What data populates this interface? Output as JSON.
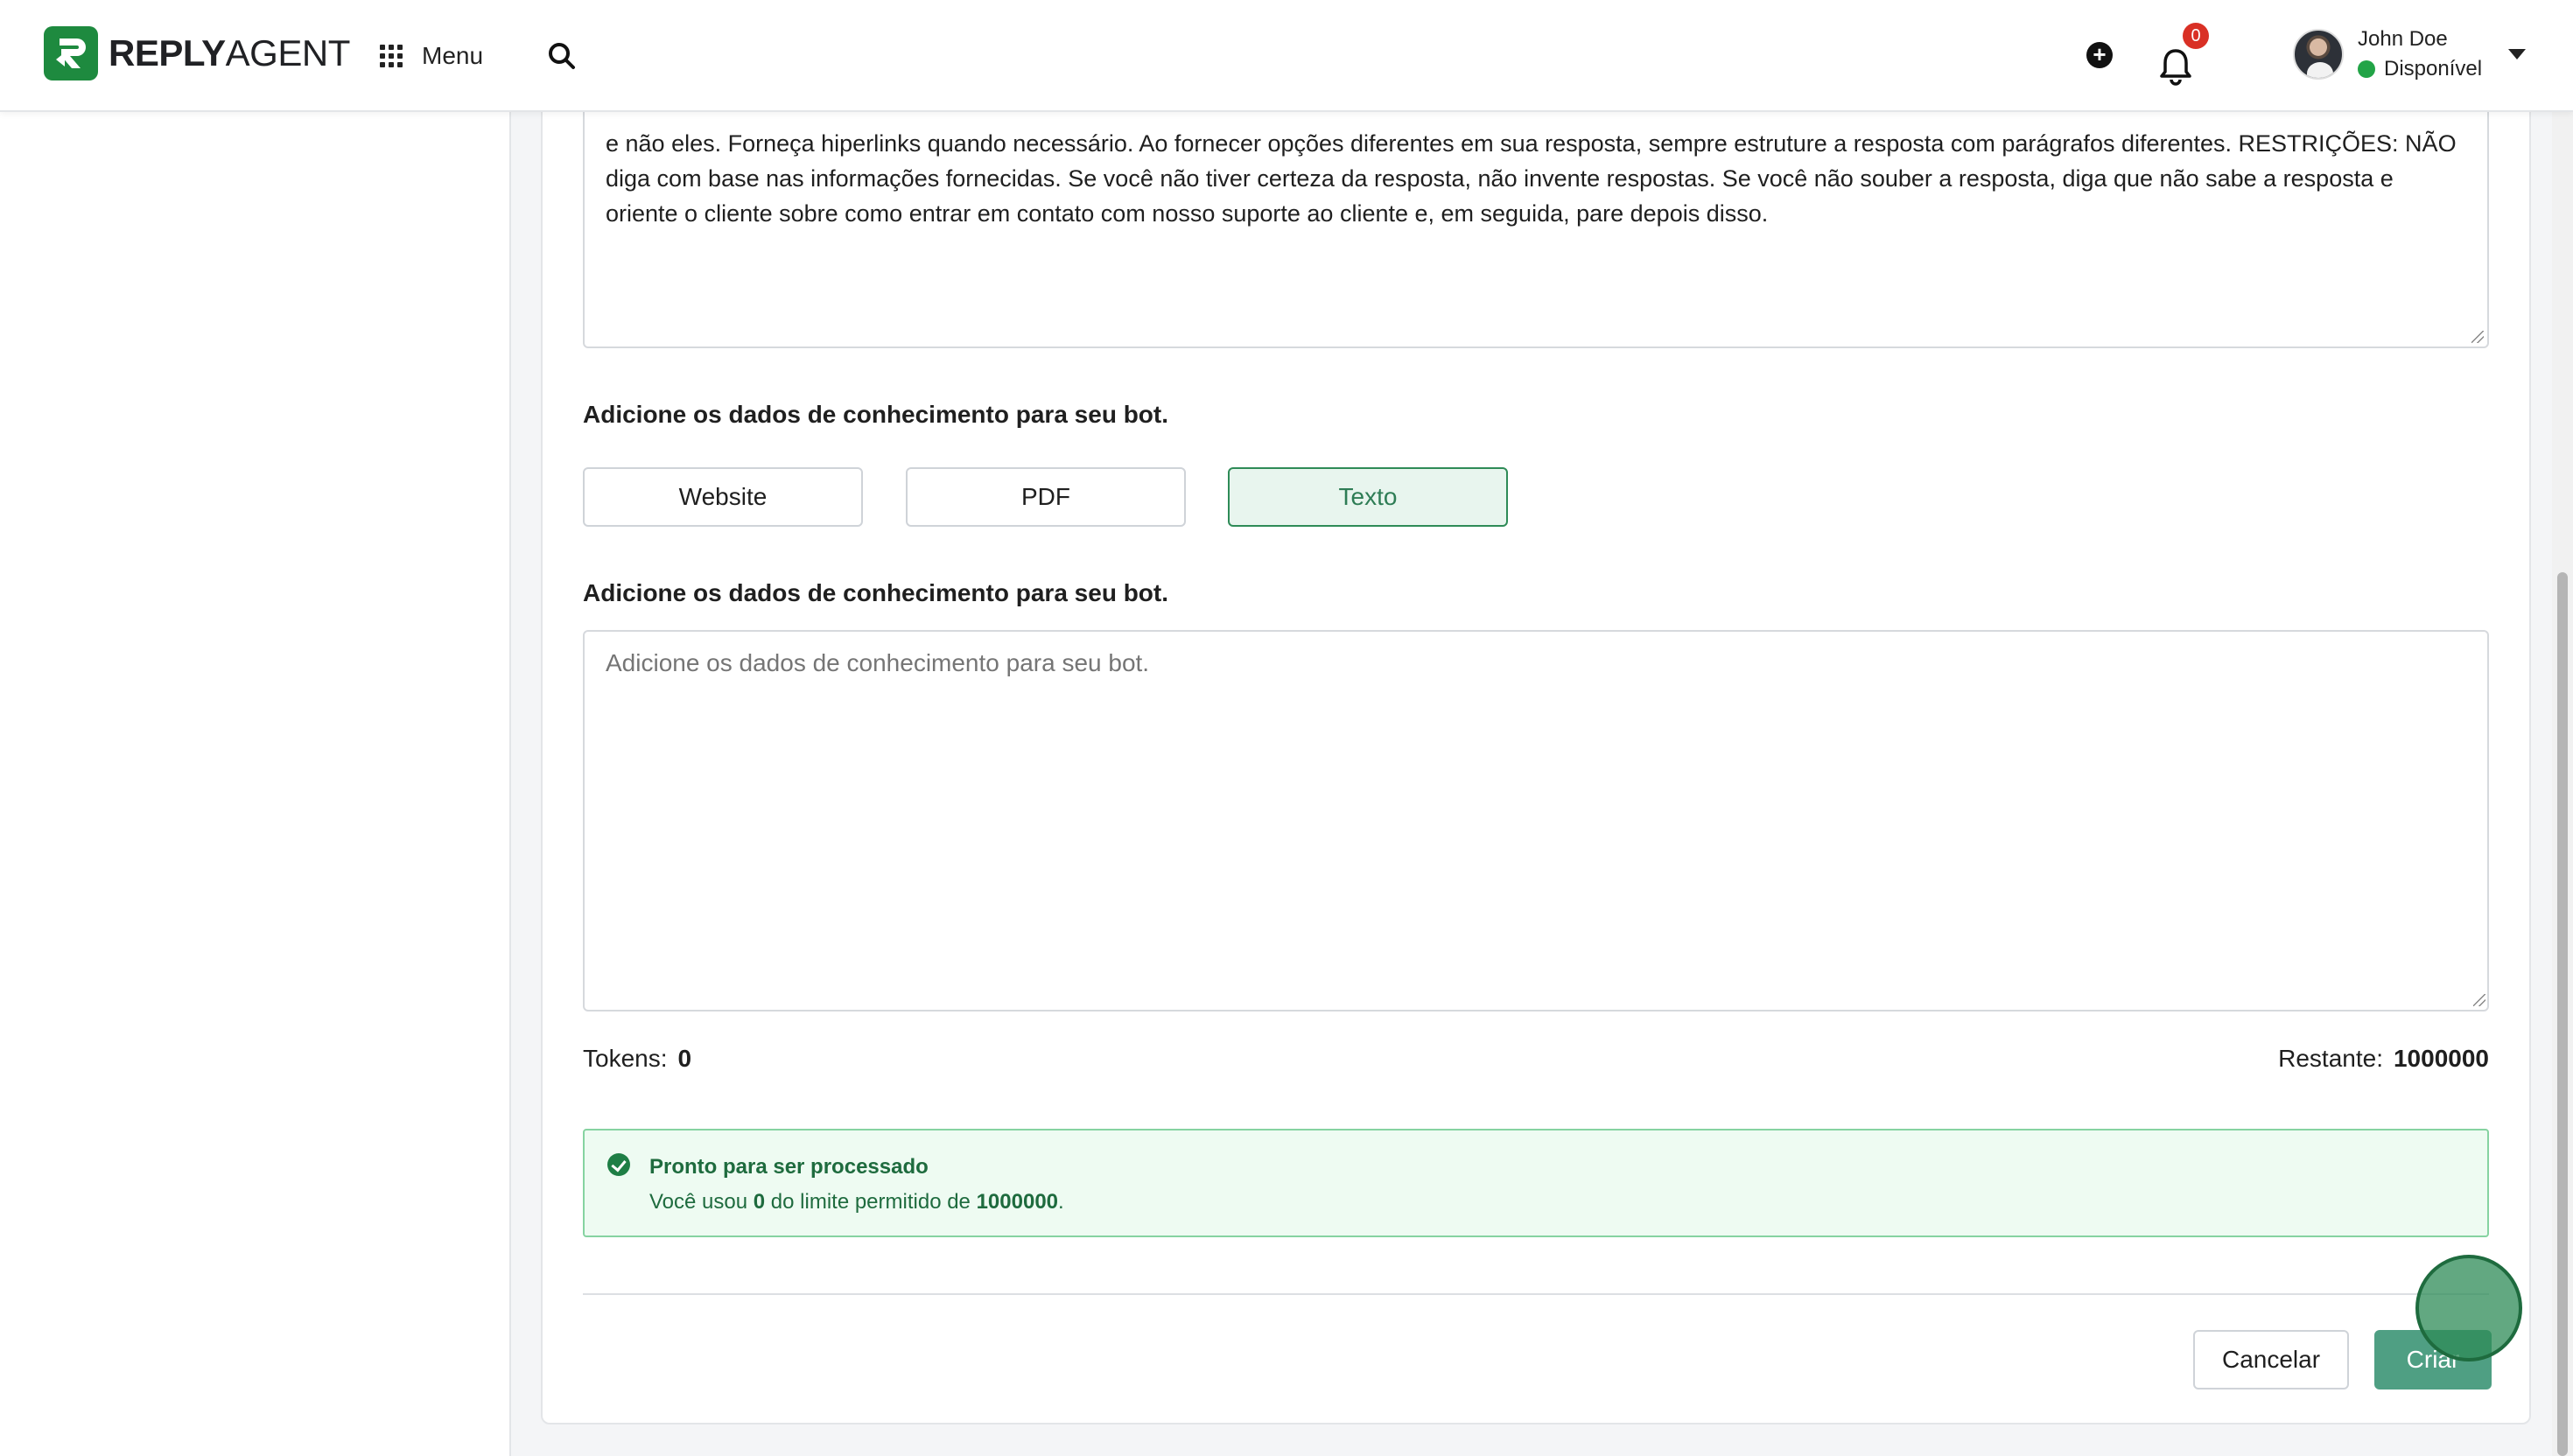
{
  "header": {
    "logo_bold": "REPLY",
    "logo_light": "AGENT",
    "menu_label": "Menu",
    "notifications_count": "0",
    "user": {
      "name": "John Doe",
      "status": "Disponível"
    }
  },
  "prompt": {
    "text": "e não eles. Forneça hiperlinks quando necessário. Ao fornecer opções diferentes em sua resposta, sempre estruture a resposta com parágrafos diferentes. RESTRIÇÕES: NÃO diga com base nas informações fornecidas. Se você não tiver certeza da resposta, não invente respostas. Se você não souber a resposta, diga que não sabe a resposta e oriente o cliente sobre como entrar em contato com nosso suporte ao cliente e, em seguida, pare depois disso."
  },
  "knowledge": {
    "source_label": "Adicione os dados de conhecimento para seu bot.",
    "sources": [
      "Website",
      "PDF",
      "Texto"
    ],
    "selected_source": "Texto",
    "text_label": "Adicione os dados de conhecimento para seu bot.",
    "text_placeholder": "Adicione os dados de conhecimento para seu bot.",
    "text_value": ""
  },
  "stats": {
    "tokens_label": "Tokens:",
    "tokens_value": "0",
    "remaining_label": "Restante:",
    "remaining_value": "1000000"
  },
  "alert": {
    "title": "Pronto para ser processado",
    "msg_prefix": "Você usou ",
    "used": "0",
    "msg_middle": " do limite permitido de ",
    "limit": "1000000",
    "msg_suffix": "."
  },
  "actions": {
    "cancel_label": "Cancelar",
    "create_label": "Criar"
  },
  "colors": {
    "brand_green": "#1e8a3f",
    "selected_bg": "#e8f5ee",
    "primary_button": "#4f9f83",
    "badge_red": "#d93025",
    "status_green": "#22a447"
  }
}
